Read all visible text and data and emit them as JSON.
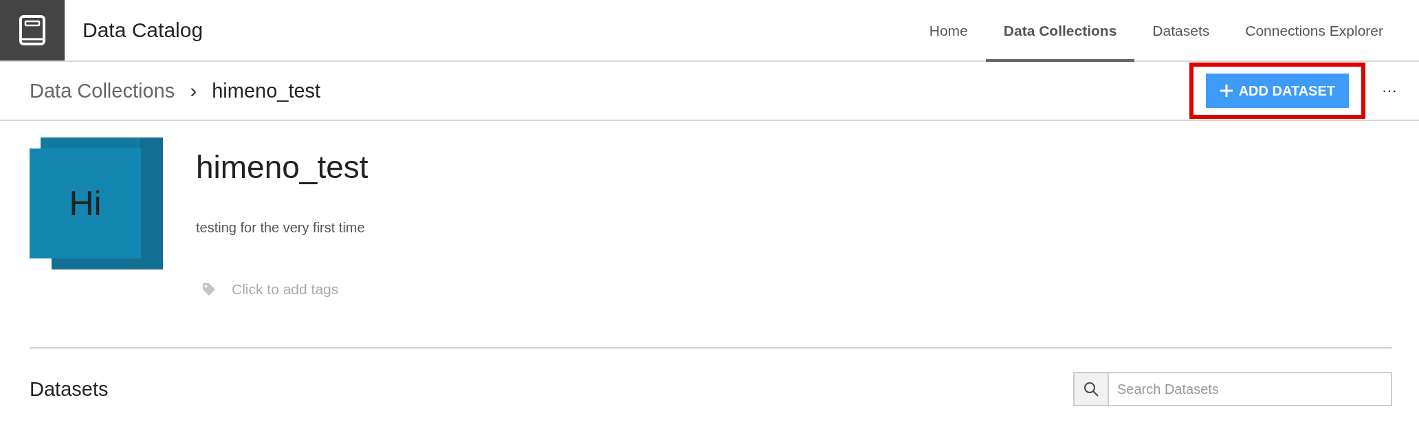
{
  "app": {
    "title": "Data Catalog"
  },
  "nav": [
    {
      "label": "Home",
      "selected": false
    },
    {
      "label": "Data Collections",
      "selected": true
    },
    {
      "label": "Datasets",
      "selected": false
    },
    {
      "label": "Connections Explorer",
      "selected": false
    }
  ],
  "breadcrumb": {
    "parent": "Data Collections",
    "separator": "›",
    "current": "himeno_test"
  },
  "actions": {
    "add_button": "ADD DATASET",
    "highlighted": true,
    "more": "···"
  },
  "collection": {
    "initials": "Hi",
    "name": "himeno_test",
    "description": "testing for the very first time",
    "tags_placeholder": "Click to add tags"
  },
  "datasets": {
    "heading": "Datasets",
    "search": {
      "placeholder": "Search Datasets"
    }
  }
}
